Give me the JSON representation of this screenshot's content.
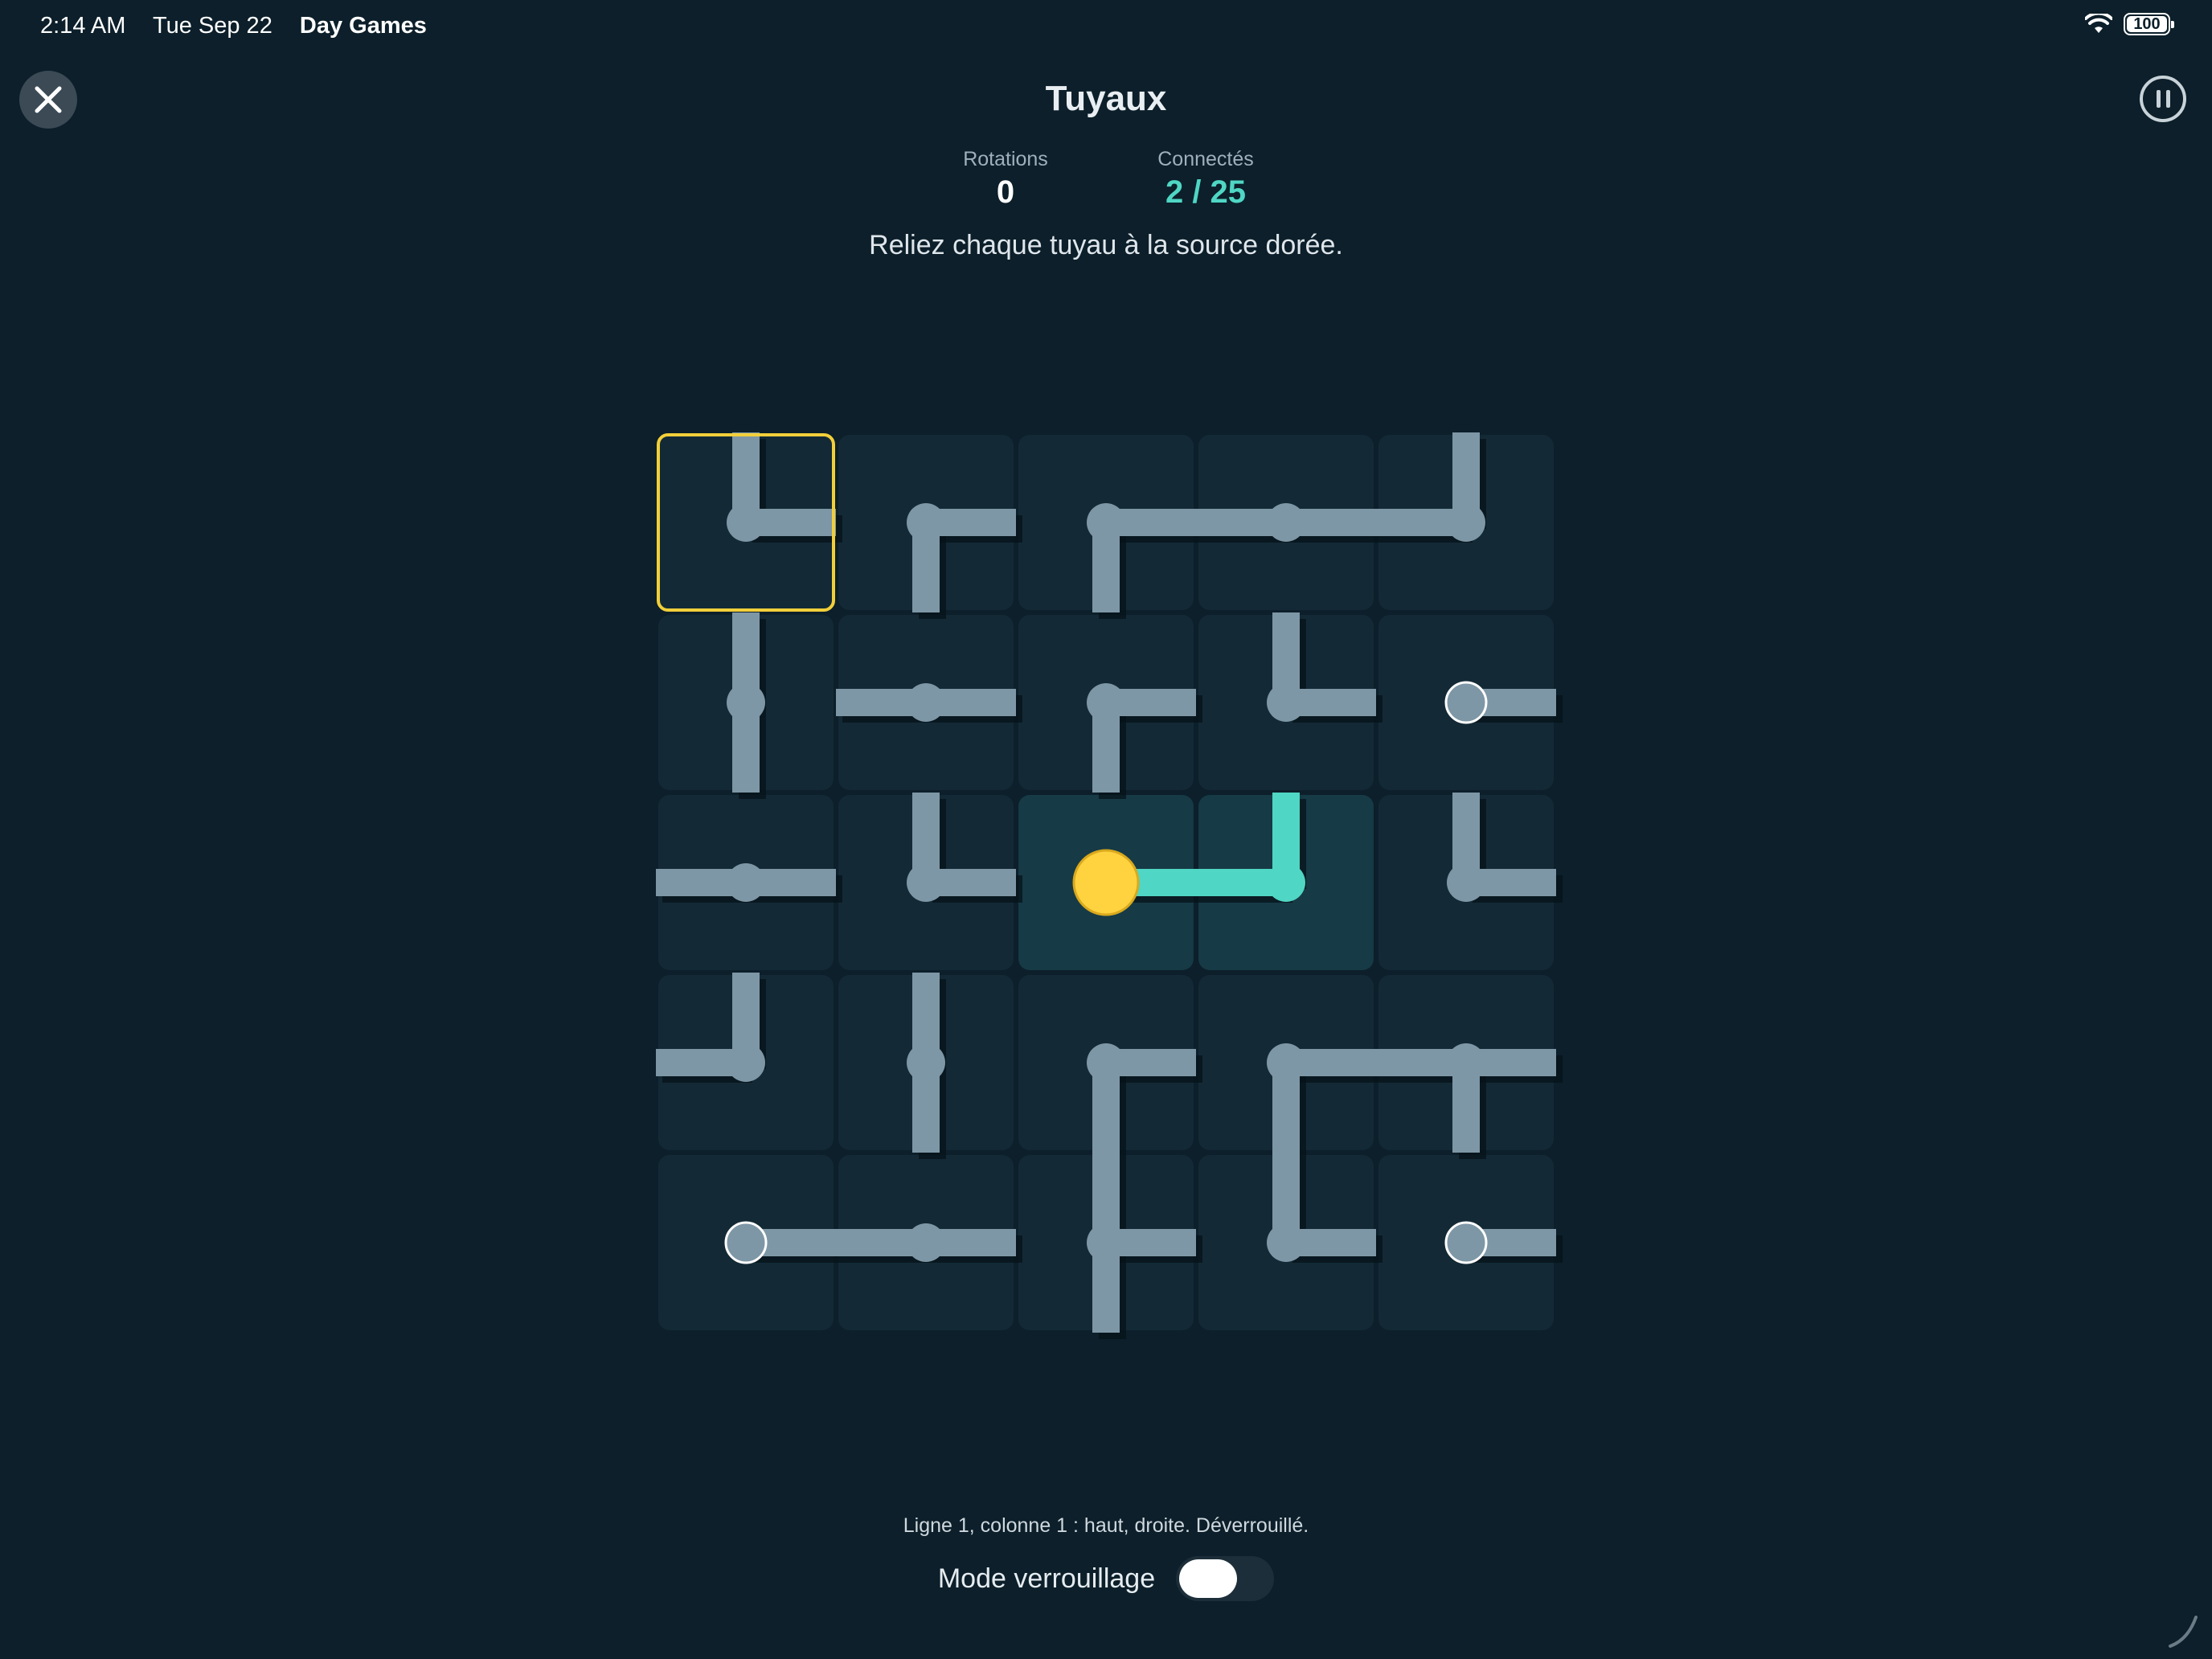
{
  "status_bar": {
    "time": "2:14 AM",
    "date": "Tue Sep 22",
    "app": "Day Games",
    "battery": "100"
  },
  "header": {
    "title": "Tuyaux"
  },
  "stats": {
    "rotations_label": "Rotations",
    "rotations_value": "0",
    "connected_label": "Connectés",
    "connected_value": "2 / 25"
  },
  "instruction": "Reliez chaque tuyau à la source dorée.",
  "board": {
    "rows": 5,
    "cols": 5,
    "selected": [
      0,
      0
    ],
    "source": [
      2,
      2
    ],
    "cells": [
      [
        {
          "dirs": [
            "up",
            "right"
          ],
          "type": "pipe"
        },
        {
          "dirs": [
            "right",
            "down"
          ],
          "type": "pipe"
        },
        {
          "dirs": [
            "right",
            "down"
          ],
          "type": "pipe"
        },
        {
          "dirs": [
            "left",
            "right"
          ],
          "type": "pipe"
        },
        {
          "dirs": [
            "up",
            "left"
          ],
          "type": "pipe"
        }
      ],
      [
        {
          "dirs": [
            "up",
            "down"
          ],
          "type": "pipe"
        },
        {
          "dirs": [
            "left",
            "right"
          ],
          "type": "pipe"
        },
        {
          "dirs": [
            "right",
            "down"
          ],
          "type": "pipe"
        },
        {
          "dirs": [
            "up",
            "right"
          ],
          "type": "pipe"
        },
        {
          "dirs": [
            "right"
          ],
          "type": "end"
        }
      ],
      [
        {
          "dirs": [
            "left",
            "right"
          ],
          "type": "pipe"
        },
        {
          "dirs": [
            "up",
            "right"
          ],
          "type": "pipe"
        },
        {
          "dirs": [
            "right"
          ],
          "type": "source"
        },
        {
          "dirs": [
            "up",
            "left"
          ],
          "type": "pipe",
          "connected": true
        },
        {
          "dirs": [
            "up",
            "right"
          ],
          "type": "pipe"
        }
      ],
      [
        {
          "dirs": [
            "up",
            "left"
          ],
          "type": "pipe"
        },
        {
          "dirs": [
            "up",
            "down"
          ],
          "type": "pipe"
        },
        {
          "dirs": [
            "right",
            "down"
          ],
          "type": "pipe"
        },
        {
          "dirs": [
            "right",
            "down"
          ],
          "type": "pipe"
        },
        {
          "dirs": [
            "left",
            "right",
            "down"
          ],
          "type": "pipe"
        }
      ],
      [
        {
          "dirs": [
            "right"
          ],
          "type": "end"
        },
        {
          "dirs": [
            "left",
            "right"
          ],
          "type": "pipe"
        },
        {
          "dirs": [
            "up",
            "right",
            "down"
          ],
          "type": "pipe"
        },
        {
          "dirs": [
            "up",
            "right"
          ],
          "type": "pipe"
        },
        {
          "dirs": [
            "right"
          ],
          "type": "end"
        }
      ]
    ]
  },
  "cell_description": "Ligne 1, colonne 1 : haut, droite. Déverrouillé.",
  "lock_mode": {
    "label": "Mode verrouillage",
    "enabled": false
  },
  "colors": {
    "background": "#0c1f2a",
    "tile": "#132a36",
    "tile_connected": "#163a46",
    "pipe": "#7e97a6",
    "pipe_connected": "#4fd6c4",
    "source": "#ffd23f",
    "selection": "#f2cf3a"
  },
  "icons": {
    "close": "close-icon",
    "pause": "pause-icon",
    "wifi": "wifi-icon",
    "battery": "battery-icon"
  }
}
